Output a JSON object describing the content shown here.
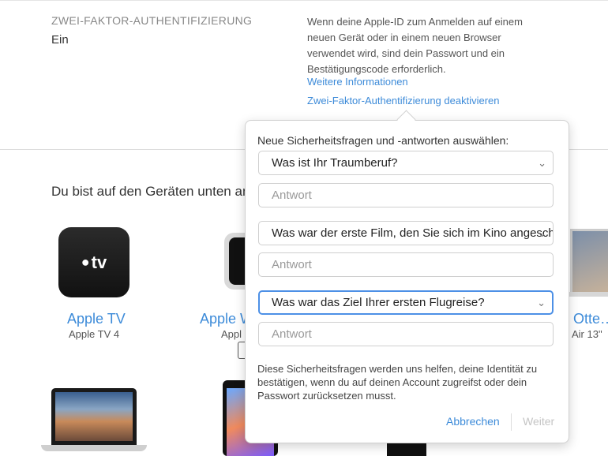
{
  "two_factor": {
    "label": "ZWEI-FAKTOR-AUTHENTIFIZIERUNG",
    "value": "Ein",
    "description": "Wenn deine Apple-ID zum Anmelden auf einem neuen Gerät oder in einem neuen Browser verwendet wird, sind dein Passwort und ein Bestätigungscode erforderlich.",
    "more_info_link": "Weitere Informationen",
    "disable_link": "Zwei-Faktor-Authentifizierung deaktivieren"
  },
  "devices": {
    "heading": "Du bist auf den Geräten unten an",
    "items": [
      {
        "name": "Apple TV",
        "model": "Apple TV 4",
        "icon": "apple-tv-icon",
        "icon_text": "tv"
      },
      {
        "name": "Apple W",
        "model": "Appl",
        "icon": "apple-watch-icon"
      },
      {
        "name": "Otte…",
        "model": "Air 13\"",
        "icon": "macbook-air-icon"
      }
    ]
  },
  "security_popover": {
    "title": "Neue Sicherheitsfragen und -antworten auswählen:",
    "questions": [
      {
        "selected": "Was ist Ihr Traumberuf?",
        "answer_placeholder": "Antwort"
      },
      {
        "selected": "Was war der erste Film, den Sie sich im Kino angeschaut haben?",
        "answer_placeholder": "Antwort"
      },
      {
        "selected": "Was war das Ziel Ihrer ersten Flugreise?",
        "answer_placeholder": "Antwort"
      }
    ],
    "help_text": "Diese Sicherheitsfragen werden uns helfen, deine Identität zu bestätigen, wenn du auf deinen Account zugreifst oder dein Passwort zurücksetzen musst.",
    "cancel_label": "Abbrechen",
    "next_label": "Weiter"
  },
  "colors": {
    "link": "#3d8bd9",
    "focus": "#4d90e6",
    "disabled": "#c4c4c4"
  }
}
